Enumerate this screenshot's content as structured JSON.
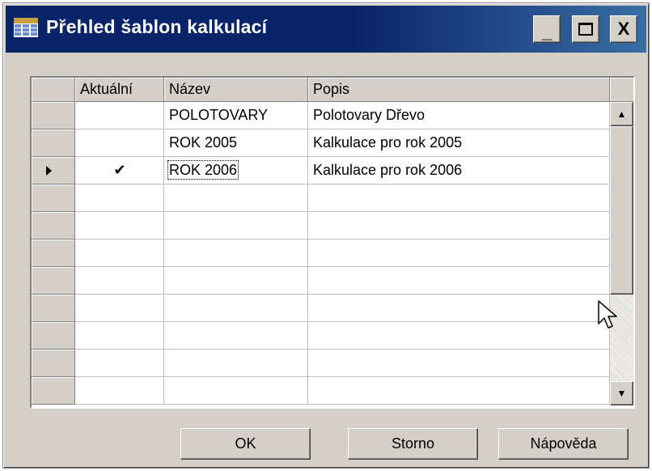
{
  "window": {
    "title": "Přehled šablon kalkulací",
    "titlebar_color": "#0a246a",
    "min_label": "_",
    "max_label": "□",
    "close_label": "X"
  },
  "table": {
    "columns": [
      "Aktuální",
      "Název",
      "Popis"
    ],
    "rows": [
      {
        "current": "",
        "name": "POLOTOVARY",
        "description": "Polotovary Dřevo"
      },
      {
        "current": "",
        "name": "ROK 2005",
        "description": "Kalkulace pro rok 2005"
      },
      {
        "current": "✔",
        "name": "ROK 2006",
        "description": "Kalkulace pro rok 2006"
      }
    ],
    "selected_row": 3
  },
  "scrollbar": {
    "up_icon": "▲",
    "down_icon": "▼"
  },
  "buttons": {
    "ok": "OK",
    "cancel": "Storno",
    "help": "Nápověda"
  }
}
